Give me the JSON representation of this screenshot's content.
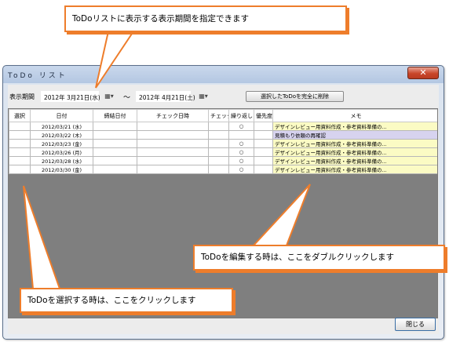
{
  "callouts": {
    "top": "ToDoリストに表示する表示期間を指定できます",
    "edit": "ToDoを編集する時は、ここをダブルクリックします",
    "select": "ToDoを選択する時は、ここをクリックします"
  },
  "window": {
    "title": "ToDo リスト",
    "close_glyph": "✕"
  },
  "toolbar": {
    "period_label": "表示期間",
    "date_from": "2012年 3月21日(水)",
    "tilde": "～",
    "date_to": "2012年 4月21日(土)",
    "calendar_glyph": "▦▾",
    "delete_label": "選択したToDoを完全に削除"
  },
  "table": {
    "headers": [
      "選択",
      "日付",
      "締結日付",
      "チェック日時",
      "チェック",
      "繰り返し",
      "優先度",
      "メモ"
    ],
    "rows": [
      {
        "date": "2012/03/21 (水)",
        "repeat": "○",
        "memo": "デザインレビュー用資料作成・参考資料準備の..."
      },
      {
        "date": "2012/03/22 (木)",
        "repeat": "",
        "memo": "見積もり依頼の再確認"
      },
      {
        "date": "2012/03/23 (金)",
        "repeat": "○",
        "memo": "デザインレビュー用資料作成・参考資料準備の..."
      },
      {
        "date": "2012/03/26 (月)",
        "repeat": "○",
        "memo": "デザインレビュー用資料作成・参考資料準備の..."
      },
      {
        "date": "2012/03/28 (水)",
        "repeat": "○",
        "memo": "デザインレビュー用資料作成・参考資料準備の..."
      },
      {
        "date": "2012/03/30 (金)",
        "repeat": "○",
        "memo": "デザインレビュー用資料作成・参考資料準備の..."
      }
    ]
  },
  "footer": {
    "close_label": "閉じる"
  },
  "colors": {
    "callout_border": "#ee7d2b",
    "memo_bg": "#fbfbc4",
    "memo_selected_bg": "#d7d3ef"
  }
}
